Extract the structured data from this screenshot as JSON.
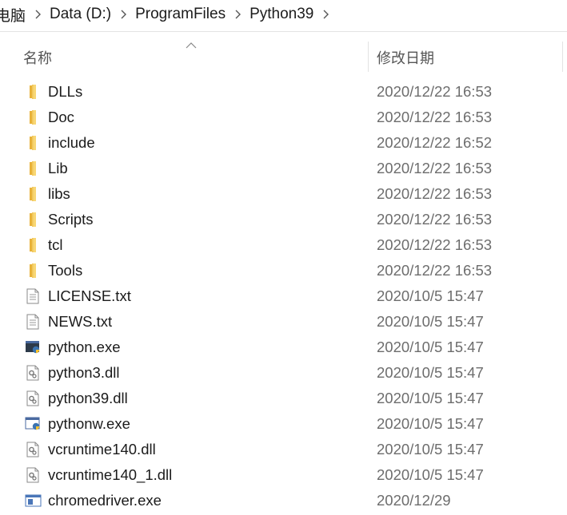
{
  "breadcrumb": [
    "电脑",
    "Data (D:)",
    "ProgramFiles",
    "Python39"
  ],
  "columns": {
    "name": "名称",
    "date": "修改日期"
  },
  "files": [
    {
      "name": "DLLs",
      "date": "2020/12/22 16:53",
      "icon": "folder-icon"
    },
    {
      "name": "Doc",
      "date": "2020/12/22 16:53",
      "icon": "folder-icon"
    },
    {
      "name": "include",
      "date": "2020/12/22 16:52",
      "icon": "folder-icon"
    },
    {
      "name": "Lib",
      "date": "2020/12/22 16:53",
      "icon": "folder-icon"
    },
    {
      "name": "libs",
      "date": "2020/12/22 16:53",
      "icon": "folder-icon"
    },
    {
      "name": "Scripts",
      "date": "2020/12/22 16:53",
      "icon": "folder-icon"
    },
    {
      "name": "tcl",
      "date": "2020/12/22 16:53",
      "icon": "folder-icon"
    },
    {
      "name": "Tools",
      "date": "2020/12/22 16:53",
      "icon": "folder-icon"
    },
    {
      "name": "LICENSE.txt",
      "date": "2020/10/5 15:47",
      "icon": "text-file-icon"
    },
    {
      "name": "NEWS.txt",
      "date": "2020/10/5 15:47",
      "icon": "text-file-icon"
    },
    {
      "name": "python.exe",
      "date": "2020/10/5 15:47",
      "icon": "python-exe-icon"
    },
    {
      "name": "python3.dll",
      "date": "2020/10/5 15:47",
      "icon": "dll-file-icon"
    },
    {
      "name": "python39.dll",
      "date": "2020/10/5 15:47",
      "icon": "dll-file-icon"
    },
    {
      "name": "pythonw.exe",
      "date": "2020/10/5 15:47",
      "icon": "pythonw-exe-icon"
    },
    {
      "name": "vcruntime140.dll",
      "date": "2020/10/5 15:47",
      "icon": "dll-file-icon"
    },
    {
      "name": "vcruntime140_1.dll",
      "date": "2020/10/5 15:47",
      "icon": "dll-file-icon"
    },
    {
      "name": "chromedriver.exe",
      "date": "2020/12/29 ",
      "icon": "app-exe-icon"
    }
  ],
  "colors": {
    "folder": "#f8d775",
    "folder_dark": "#e8b23a",
    "text": "#1b1b1b",
    "date": "#6d6d6d"
  }
}
